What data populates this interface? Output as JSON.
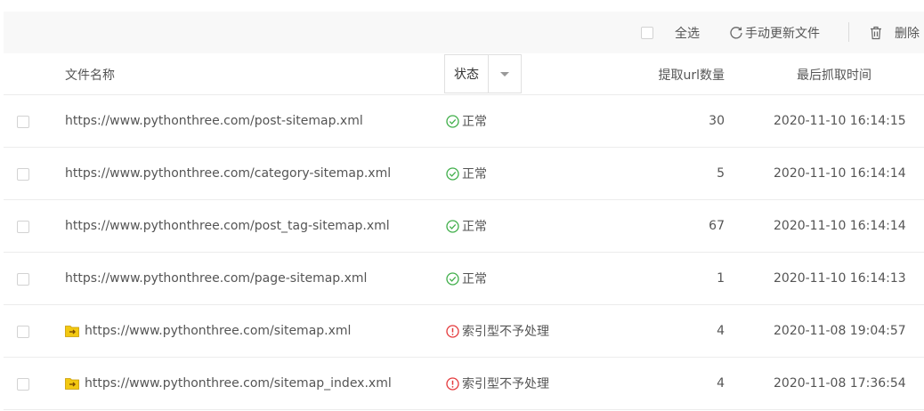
{
  "toolbar": {
    "select_all": "全选",
    "refresh": "手动更新文件",
    "delete": "删除"
  },
  "header": {
    "name": "文件名称",
    "status": "状态",
    "count": "提取url数量",
    "time": "最后抓取时间"
  },
  "rows": [
    {
      "url": "https://www.pythonthree.com/post-sitemap.xml",
      "status": "正常",
      "status_type": "ok",
      "count": "30",
      "time": "2020-11-10 16:14:15",
      "folder_icon": false
    },
    {
      "url": "https://www.pythonthree.com/category-sitemap.xml",
      "status": "正常",
      "status_type": "ok",
      "count": "5",
      "time": "2020-11-10 16:14:14",
      "folder_icon": false
    },
    {
      "url": "https://www.pythonthree.com/post_tag-sitemap.xml",
      "status": "正常",
      "status_type": "ok",
      "count": "67",
      "time": "2020-11-10 16:14:14",
      "folder_icon": false
    },
    {
      "url": "https://www.pythonthree.com/page-sitemap.xml",
      "status": "正常",
      "status_type": "ok",
      "count": "1",
      "time": "2020-11-10 16:14:13",
      "folder_icon": false
    },
    {
      "url": "https://www.pythonthree.com/sitemap.xml",
      "status": "索引型不予处理",
      "status_type": "warn",
      "count": "4",
      "time": "2020-11-08 19:04:57",
      "folder_icon": true
    },
    {
      "url": "https://www.pythonthree.com/sitemap_index.xml",
      "status": "索引型不予处理",
      "status_type": "warn",
      "count": "4",
      "time": "2020-11-08 17:36:54",
      "folder_icon": true
    }
  ],
  "colors": {
    "ok": "#3fae49",
    "warn": "#e4393c",
    "folder": "#f2c811"
  }
}
